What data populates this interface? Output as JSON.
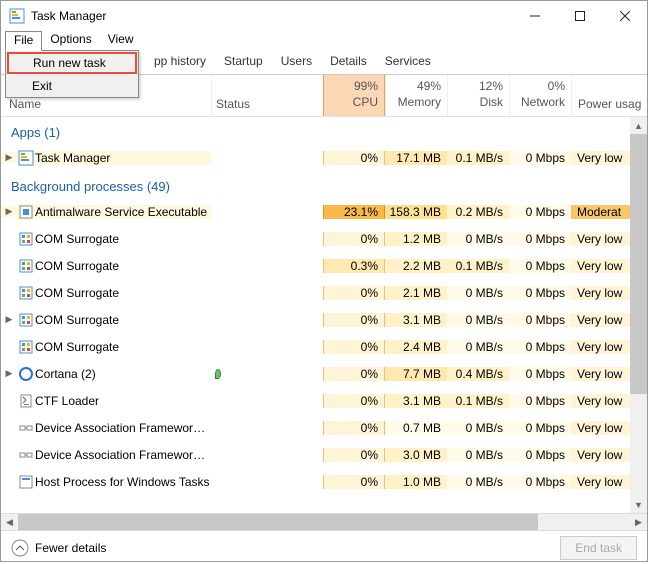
{
  "window": {
    "title": "Task Manager"
  },
  "menubar": {
    "file": "File",
    "options": "Options",
    "view": "View"
  },
  "file_menu": {
    "run_new_task": "Run new task",
    "exit": "Exit"
  },
  "tabs": {
    "app_history": "pp history",
    "startup": "Startup",
    "users": "Users",
    "details": "Details",
    "services": "Services"
  },
  "columns": {
    "name": "Name",
    "status": "Status",
    "cpu_pct": "99%",
    "cpu": "CPU",
    "mem_pct": "49%",
    "mem": "Memory",
    "disk_pct": "12%",
    "disk": "Disk",
    "net_pct": "0%",
    "net": "Network",
    "power": "Power usag"
  },
  "groups": {
    "apps": "Apps (1)",
    "bg": "Background processes (49)"
  },
  "rows": [
    {
      "group": "apps",
      "exp": true,
      "icon": "tm",
      "name": "Task Manager",
      "cpu": "0%",
      "cpu_cls": "cpu0",
      "mem": "17.1 MB",
      "mem_cls": "mem2",
      "disk": "0.1 MB/s",
      "disk_cls": "disk1",
      "net": "0 Mbps",
      "pow": "Very low",
      "pow_cls": "pow-vl",
      "status_icon": ""
    },
    {
      "group": "bg",
      "exp": true,
      "icon": "shield",
      "name": "Antimalware Service Executable",
      "cpu": "23.1%",
      "cpu_cls": "cpu1",
      "mem": "158.3 MB",
      "mem_cls": "mem3",
      "disk": "0.2 MB/s",
      "disk_cls": "disk1",
      "net": "0 Mbps",
      "pow": "Moderat",
      "pow_cls": "pow-mod",
      "status_icon": ""
    },
    {
      "group": "bg",
      "exp": false,
      "icon": "com",
      "name": "COM Surrogate",
      "cpu": "0%",
      "cpu_cls": "cpu0",
      "mem": "1.2 MB",
      "mem_cls": "mem1",
      "disk": "0 MB/s",
      "disk_cls": "disk0",
      "net": "0 Mbps",
      "pow": "Very low",
      "pow_cls": "pow-vl",
      "status_icon": ""
    },
    {
      "group": "bg",
      "exp": false,
      "icon": "com",
      "name": "COM Surrogate",
      "cpu": "0.3%",
      "cpu_cls": "cpu03",
      "mem": "2.2 MB",
      "mem_cls": "mem1",
      "disk": "0.1 MB/s",
      "disk_cls": "disk1",
      "net": "0 Mbps",
      "pow": "Very low",
      "pow_cls": "pow-vl",
      "status_icon": ""
    },
    {
      "group": "bg",
      "exp": false,
      "icon": "com",
      "name": "COM Surrogate",
      "cpu": "0%",
      "cpu_cls": "cpu0",
      "mem": "2.1 MB",
      "mem_cls": "mem1",
      "disk": "0 MB/s",
      "disk_cls": "disk0",
      "net": "0 Mbps",
      "pow": "Very low",
      "pow_cls": "pow-vl",
      "status_icon": ""
    },
    {
      "group": "bg",
      "exp": true,
      "icon": "com",
      "name": "COM Surrogate",
      "cpu": "0%",
      "cpu_cls": "cpu0",
      "mem": "3.1 MB",
      "mem_cls": "mem1",
      "disk": "0 MB/s",
      "disk_cls": "disk0",
      "net": "0 Mbps",
      "pow": "Very low",
      "pow_cls": "pow-vl",
      "status_icon": ""
    },
    {
      "group": "bg",
      "exp": false,
      "icon": "com",
      "name": "COM Surrogate",
      "cpu": "0%",
      "cpu_cls": "cpu0",
      "mem": "2.4 MB",
      "mem_cls": "mem1",
      "disk": "0 MB/s",
      "disk_cls": "disk0",
      "net": "0 Mbps",
      "pow": "Very low",
      "pow_cls": "pow-vl",
      "status_icon": ""
    },
    {
      "group": "bg",
      "exp": true,
      "icon": "cortana",
      "name": "Cortana (2)",
      "cpu": "0%",
      "cpu_cls": "cpu0",
      "mem": "7.7 MB",
      "mem_cls": "mem2",
      "disk": "0.4 MB/s",
      "disk_cls": "disk1",
      "net": "0 Mbps",
      "pow": "Very low",
      "pow_cls": "pow-vl",
      "status_icon": "leaf"
    },
    {
      "group": "bg",
      "exp": false,
      "icon": "ctf",
      "name": "CTF Loader",
      "cpu": "0%",
      "cpu_cls": "cpu0",
      "mem": "3.1 MB",
      "mem_cls": "mem1",
      "disk": "0.1 MB/s",
      "disk_cls": "disk1",
      "net": "0 Mbps",
      "pow": "Very low",
      "pow_cls": "pow-vl",
      "status_icon": ""
    },
    {
      "group": "bg",
      "exp": false,
      "icon": "daf",
      "name": "Device Association Framework ...",
      "cpu": "0%",
      "cpu_cls": "cpu0",
      "mem": "0.7 MB",
      "mem_cls": "mem0",
      "disk": "0 MB/s",
      "disk_cls": "disk0",
      "net": "0 Mbps",
      "pow": "Very low",
      "pow_cls": "pow-vl",
      "status_icon": ""
    },
    {
      "group": "bg",
      "exp": false,
      "icon": "daf",
      "name": "Device Association Framework ...",
      "cpu": "0%",
      "cpu_cls": "cpu0",
      "mem": "3.0 MB",
      "mem_cls": "mem1",
      "disk": "0 MB/s",
      "disk_cls": "disk0",
      "net": "0 Mbps",
      "pow": "Very low",
      "pow_cls": "pow-vl",
      "status_icon": ""
    },
    {
      "group": "bg",
      "exp": false,
      "icon": "host",
      "name": "Host Process for Windows Tasks",
      "cpu": "0%",
      "cpu_cls": "cpu0",
      "mem": "1.0 MB",
      "mem_cls": "mem1",
      "disk": "0 MB/s",
      "disk_cls": "disk0",
      "net": "0 Mbps",
      "pow": "Very low",
      "pow_cls": "pow-vl",
      "status_icon": ""
    }
  ],
  "footer": {
    "fewer": "Fewer details",
    "end_task": "End task"
  }
}
